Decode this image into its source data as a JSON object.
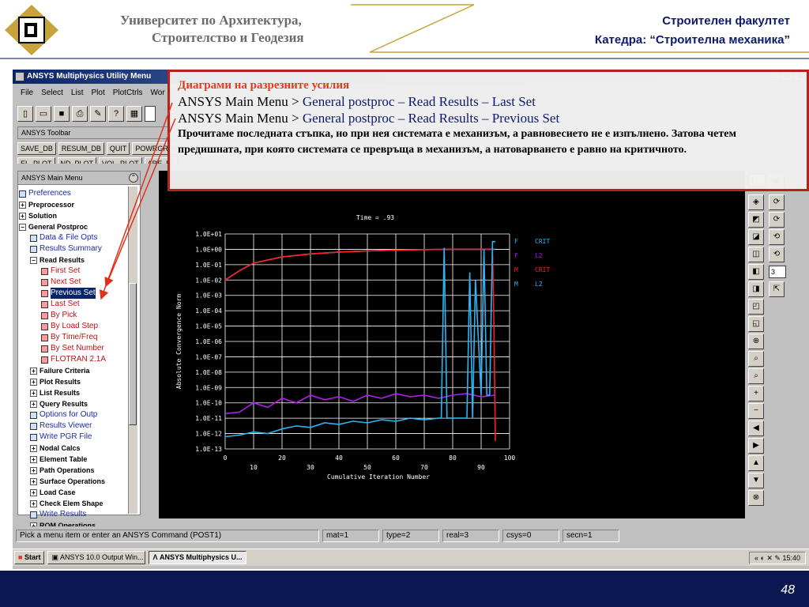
{
  "slide": {
    "university_line1": "Университет по Архитектура,",
    "university_line2": "Строителство и Геодезия",
    "faculty": "Строителен факултет",
    "department": "Катедра: “Строителна механика”",
    "page_number": "48"
  },
  "annotation": {
    "title": "Диаграми на разрезните усилия",
    "line1_prefix": "ANSYS Main Menu >",
    "line1_path": "General postproc – Read Results – Last Set",
    "line2_prefix": "ANSYS Main Menu >",
    "line2_path": "General postproc – Read Results – Previous Set",
    "note": "Прочитаме последната стъпка, но при нея системата е механизъм, а равновесието не е изпълнено. Затова четем предишната, при която системата се превръща в механизъм, а натоварването е равно на критичното."
  },
  "window": {
    "title": "ANSYS Multiphysics Utility Menu",
    "menubar": [
      "File",
      "Select",
      "List",
      "Plot",
      "PlotCtrls",
      "Wor"
    ],
    "toolbar_label": "ANSYS Toolbar",
    "commands": [
      "SAVE_DB",
      "RESUM_DB",
      "QUIT",
      "POWRGRPH"
    ],
    "commands_row2": [
      "EL_PLOT",
      "ND_PLOT",
      "VOL_PLOT",
      "ARE_PL"
    ]
  },
  "main_menu": {
    "title": "ANSYS Main Menu",
    "items": [
      {
        "label": "Preferences",
        "kind": "icon",
        "indent": 0
      },
      {
        "label": "Preprocessor",
        "kind": "plus",
        "indent": 0
      },
      {
        "label": "Solution",
        "kind": "plus",
        "indent": 0
      },
      {
        "label": "General Postproc",
        "kind": "minus",
        "indent": 0
      },
      {
        "label": "Data & File Opts",
        "kind": "icon",
        "indent": 1
      },
      {
        "label": "Results Summary",
        "kind": "icon",
        "indent": 1
      },
      {
        "label": "Read Results",
        "kind": "minus",
        "indent": 1
      },
      {
        "label": "First Set",
        "kind": "icon-red",
        "indent": 2
      },
      {
        "label": "Next Set",
        "kind": "icon-red",
        "indent": 2
      },
      {
        "label": "Previous Set",
        "kind": "icon-red",
        "indent": 2,
        "selected": true
      },
      {
        "label": "Last Set",
        "kind": "icon-red",
        "indent": 2
      },
      {
        "label": "By Pick",
        "kind": "icon-red",
        "indent": 2
      },
      {
        "label": "By Load Step",
        "kind": "icon-red",
        "indent": 2
      },
      {
        "label": "By Time/Freq",
        "kind": "icon-red",
        "indent": 2
      },
      {
        "label": "By Set Number",
        "kind": "icon-red",
        "indent": 2
      },
      {
        "label": "FLOTRAN 2.1A",
        "kind": "icon-red",
        "indent": 2
      },
      {
        "label": "Failure Criteria",
        "kind": "plus",
        "indent": 1
      },
      {
        "label": "Plot Results",
        "kind": "plus",
        "indent": 1
      },
      {
        "label": "List Results",
        "kind": "plus",
        "indent": 1
      },
      {
        "label": "Query Results",
        "kind": "plus",
        "indent": 1
      },
      {
        "label": "Options for Outp",
        "kind": "icon",
        "indent": 1
      },
      {
        "label": "Results Viewer",
        "kind": "icon",
        "indent": 1
      },
      {
        "label": "Write PGR File",
        "kind": "icon",
        "indent": 1
      },
      {
        "label": "Nodal Calcs",
        "kind": "plus",
        "indent": 1
      },
      {
        "label": "Element Table",
        "kind": "plus",
        "indent": 1
      },
      {
        "label": "Path Operations",
        "kind": "plus",
        "indent": 1
      },
      {
        "label": "Surface Operations",
        "kind": "plus",
        "indent": 1
      },
      {
        "label": "Load Case",
        "kind": "plus",
        "indent": 1
      },
      {
        "label": "Check Elem Shape",
        "kind": "plus",
        "indent": 1
      },
      {
        "label": "Write Results",
        "kind": "icon",
        "indent": 1
      },
      {
        "label": "ROM Operations",
        "kind": "plus",
        "indent": 1
      }
    ]
  },
  "right_toolbar": {
    "select_top": "1",
    "select_mid": "3"
  },
  "status": {
    "prompt": "Pick a menu item or enter an ANSYS Command (POST1)",
    "mat": "mat=1",
    "type": "type=2",
    "real": "real=3",
    "csys": "csys=0",
    "secn": "secn=1"
  },
  "taskbar": {
    "start": "Start",
    "task1": "ANSYS 10.0 Output Win...",
    "task2": "ANSYS Multiphysics U...",
    "clock": "15:40"
  },
  "chart_data": {
    "type": "line",
    "title": "Time = .93",
    "xlabel": "Cumulative Iteration Number",
    "ylabel": "Absolute Convergence Norm",
    "xlim": [
      0,
      100
    ],
    "x_ticks_top": [
      "0",
      "20",
      "40",
      "60",
      "80",
      "100"
    ],
    "x_ticks_bottom": [
      "10",
      "30",
      "50",
      "70",
      "90"
    ],
    "y_ticks": [
      "1.0E+01",
      "1.0E+00",
      "1.0E-01",
      "1.0E-02",
      "1.0E-03",
      "1.0E-04",
      "1.0E-05",
      "1.0E-06",
      "1.0E-07",
      "1.0E-08",
      "1.0E-09",
      "1.0E-10",
      "1.0E-11",
      "1.0E-12",
      "1.0E-13"
    ],
    "y_log_range": [
      -13,
      1
    ],
    "grid": true,
    "legend": [
      {
        "code": "F",
        "label": "CRIT",
        "color": "#29b6f6"
      },
      {
        "code": "F",
        "label": "L2",
        "color": "#b51cf0"
      },
      {
        "code": "M",
        "label": "CRIT",
        "color": "#ff2020"
      },
      {
        "code": "M",
        "label": "L2",
        "color": "#29b6f6"
      }
    ],
    "series": [
      {
        "name": "F CRIT",
        "color": "#29b6f6",
        "x": [
          0,
          5,
          10,
          20,
          30,
          40,
          50,
          60,
          70,
          80,
          90,
          95
        ],
        "log_y": [
          -2.0,
          -1.4,
          -0.9,
          -0.5,
          -0.3,
          -0.18,
          -0.1,
          -0.05,
          -0.02,
          0.0,
          0.0,
          0.0
        ]
      },
      {
        "name": "M CRIT",
        "color": "#ff2020",
        "x": [
          0,
          5,
          10,
          20,
          30,
          40,
          50,
          60,
          70,
          80,
          90,
          94,
          94.5,
          95
        ],
        "log_y": [
          -2.0,
          -1.4,
          -0.9,
          -0.5,
          -0.3,
          -0.18,
          -0.1,
          -0.05,
          -0.02,
          0.0,
          0.0,
          0.0,
          -5,
          -12.5
        ]
      },
      {
        "name": "F L2",
        "color": "#b51cf0",
        "x": [
          0,
          5,
          10,
          15,
          20,
          25,
          30,
          35,
          40,
          45,
          50,
          55,
          60,
          65,
          70,
          75,
          80,
          85,
          90,
          95
        ],
        "log_y": [
          -10.7,
          -10.6,
          -10.0,
          -10.3,
          -9.7,
          -10.0,
          -9.5,
          -9.8,
          -9.6,
          -9.9,
          -9.5,
          -9.7,
          -9.4,
          -9.6,
          -9.5,
          -9.7,
          -9.5,
          -9.4,
          -9.6,
          -9.5
        ]
      },
      {
        "name": "M L2",
        "color": "#29b6f6",
        "x": [
          0,
          5,
          10,
          15,
          20,
          25,
          30,
          35,
          40,
          45,
          50,
          55,
          60,
          65,
          70,
          75,
          76,
          77,
          78,
          80,
          85,
          86,
          87,
          88,
          90,
          91,
          92,
          93,
          94,
          95
        ],
        "log_y": [
          -12.2,
          -12.1,
          -11.9,
          -12.0,
          -11.7,
          -11.5,
          -11.6,
          -11.3,
          -11.4,
          -11.2,
          -11.3,
          -11.1,
          -11.2,
          -11.0,
          -11.1,
          -11.0,
          -11.0,
          0.1,
          -11.0,
          -11.0,
          -11.0,
          -1.5,
          -11.0,
          -2,
          -9.5,
          0,
          -9.5,
          -9.5,
          0.5,
          0.5
        ]
      }
    ]
  }
}
